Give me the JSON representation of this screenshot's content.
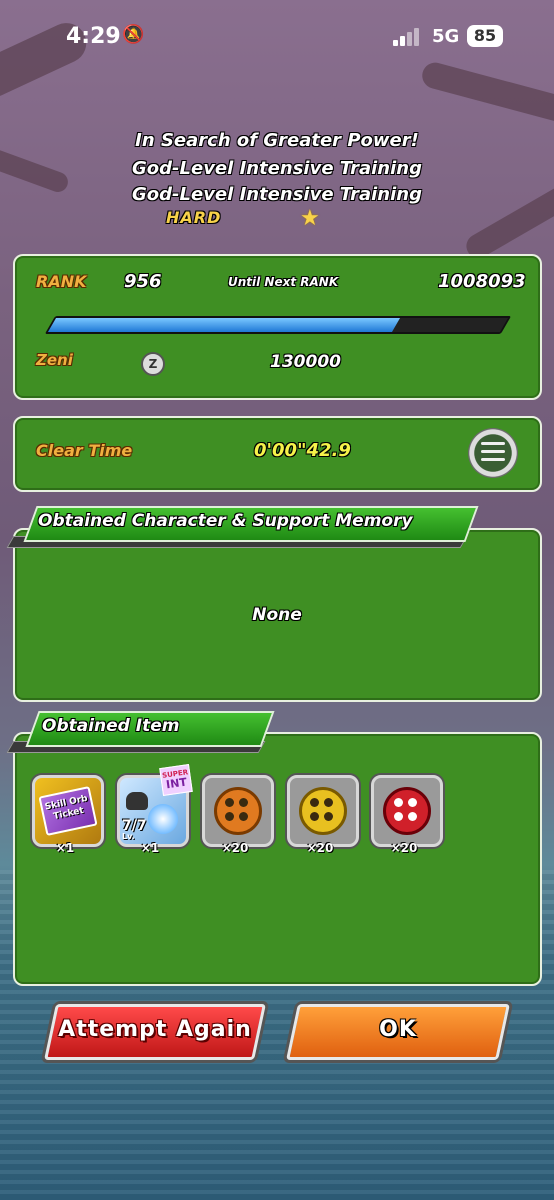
{
  "status_bar": {
    "time": "4:29",
    "network": "5G",
    "battery": "85"
  },
  "quest": {
    "line1": "In Search of Greater Power!",
    "line2": "God-Level Intensive Training",
    "line3": "God-Level Intensive Training",
    "difficulty": "HARD"
  },
  "rank_panel": {
    "rank_label": "RANK",
    "rank_value": "956",
    "until_next_label": "Until Next RANK",
    "until_next_value": "1008093",
    "progress": 0.76,
    "zeni_label": "Zeni",
    "zeni_value": "130000"
  },
  "clear_time": {
    "label": "Clear Time",
    "value": "0'00\"42.9"
  },
  "obtained_character": {
    "header": "Obtained Character & Support Memory",
    "content": "None"
  },
  "obtained_item": {
    "header": "Obtained Item",
    "items": [
      {
        "name": "skill-orb-ticket",
        "line1": "Skill Orb",
        "line2": "Ticket",
        "qty": "×1"
      },
      {
        "name": "super-int-training",
        "badge_top": "SUPER",
        "badge_bottom": "INT",
        "level": "7/7",
        "lv": "Lv.",
        "qty": "×1"
      },
      {
        "name": "orange-film-reel",
        "color": "#e07a20",
        "qty": "×20"
      },
      {
        "name": "yellow-film-reel",
        "color": "#e8c020",
        "qty": "×20"
      },
      {
        "name": "red-film-reel",
        "color": "#d0202a",
        "qty": "×20"
      }
    ]
  },
  "buttons": {
    "attempt_again": "Attempt Again",
    "ok": "OK"
  },
  "colors": {
    "panel_green": "#3f8f23",
    "rank_gold": "#f0b040",
    "time_yellow": "#f6f34a"
  }
}
